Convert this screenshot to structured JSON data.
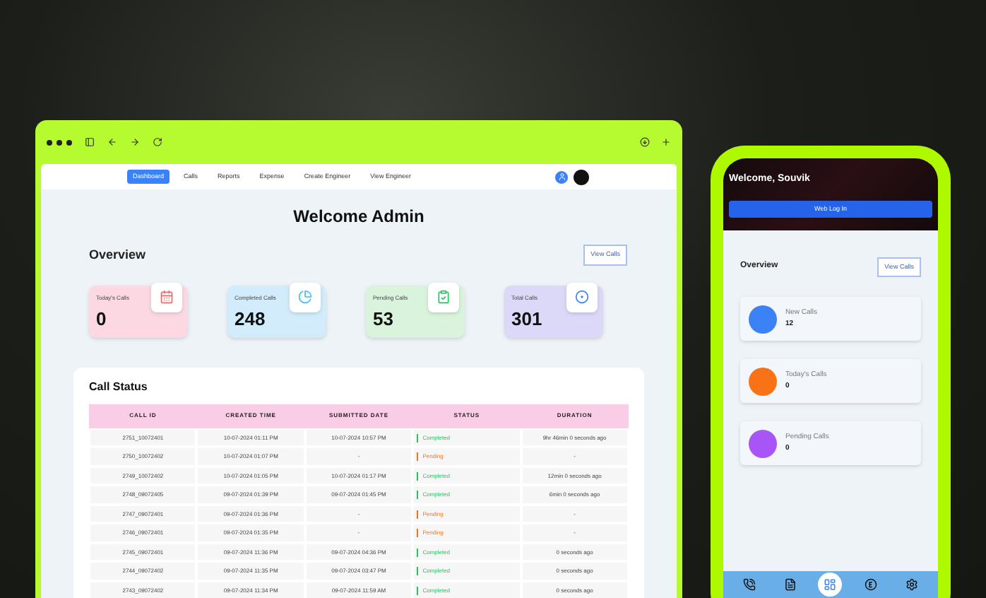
{
  "browser": {
    "nav": [
      {
        "label": "Dashboard",
        "selected": true
      },
      {
        "label": "Calls",
        "selected": false
      },
      {
        "label": "Reports",
        "selected": false
      },
      {
        "label": "Expense",
        "selected": false
      },
      {
        "label": "Create Engineer",
        "selected": false
      },
      {
        "label": "View Engineer",
        "selected": false
      }
    ],
    "title": "Welcome Admin",
    "overview": {
      "heading": "Overview",
      "button": "View Calls"
    },
    "cards": [
      {
        "label": "Today's Calls",
        "value": "0",
        "color": "#fcd9e2",
        "kind": "calendar"
      },
      {
        "label": "Completed Calls",
        "value": "248",
        "color": "#d3ecfb",
        "kind": "pie"
      },
      {
        "label": "Pending Calls",
        "value": "53",
        "color": "#d9f3dc",
        "kind": "clipboard"
      },
      {
        "label": "Total Calls",
        "value": "301",
        "color": "#dcd8f8",
        "kind": "target"
      }
    ],
    "call_status": {
      "heading": "Call Status",
      "columns": [
        "CALL ID",
        "CREATED TIME",
        "SUBMITTED DATE",
        "STATUS",
        "DURATION"
      ],
      "rows": [
        {
          "call_id": "2751_10072401",
          "created": "10-07-2024 01:11 PM",
          "submitted": "10-07-2024 10:57 PM",
          "status": "Completed",
          "kind": "completed",
          "duration": "9hr 46min 0 seconds ago"
        },
        {
          "call_id": "2750_10072402",
          "created": "10-07-2024 01:07 PM",
          "submitted": "-",
          "status": "Pending",
          "kind": "pending",
          "duration": "-"
        },
        {
          "call_id": "2749_10072402",
          "created": "10-07-2024 01:05 PM",
          "submitted": "10-07-2024 01:17 PM",
          "status": "Completed",
          "kind": "completed",
          "duration": "12min 0 seconds ago"
        },
        {
          "call_id": "2748_09072405",
          "created": "09-07-2024 01:39 PM",
          "submitted": "09-07-2024 01:45 PM",
          "status": "Completed",
          "kind": "completed",
          "duration": "6min 0 seconds ago"
        },
        {
          "call_id": "2747_09072401",
          "created": "09-07-2024 01:36 PM",
          "submitted": "-",
          "status": "Pending",
          "kind": "pending",
          "duration": "-"
        },
        {
          "call_id": "2746_09072401",
          "created": "09-07-2024 01:35 PM",
          "submitted": "-",
          "status": "Pending",
          "kind": "pending",
          "duration": "-"
        },
        {
          "call_id": "2745_09072401",
          "created": "09-07-2024 11:36 PM",
          "submitted": "09-07-2024 04:36 PM",
          "status": "Completed",
          "kind": "completed",
          "duration": "0 seconds ago"
        },
        {
          "call_id": "2744_09072402",
          "created": "09-07-2024 11:35 PM",
          "submitted": "09-07-2024 03:47 PM",
          "status": "Completed",
          "kind": "completed",
          "duration": "0 seconds ago"
        },
        {
          "call_id": "2743_09072402",
          "created": "09-07-2024 11:34 PM",
          "submitted": "09-07-2024 11:59 AM",
          "status": "Completed",
          "kind": "completed",
          "duration": "0 seconds ago"
        }
      ]
    }
  },
  "phone": {
    "greeting": "Welcome, Souvik",
    "login_button": "Web Log In",
    "overview": {
      "heading": "Overview",
      "button": "View Calls"
    },
    "stats": [
      {
        "label": "New Calls",
        "value": "12",
        "color": "#3b82f6"
      },
      {
        "label": "Today's Calls",
        "value": "0",
        "color": "#f97316"
      },
      {
        "label": "Pending Calls",
        "value": "0",
        "color": "#a855f7"
      }
    ],
    "tabs": [
      {
        "kind": "phone",
        "selected": false
      },
      {
        "kind": "form",
        "selected": false
      },
      {
        "kind": "dashboard",
        "selected": true
      },
      {
        "kind": "expense",
        "selected": false
      },
      {
        "kind": "settings",
        "selected": false
      }
    ]
  }
}
